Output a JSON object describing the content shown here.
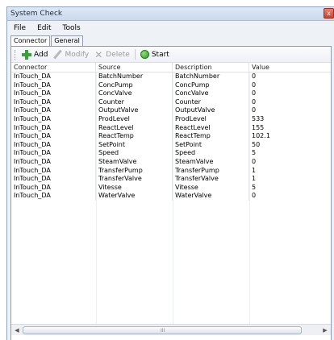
{
  "window": {
    "title": "System Check",
    "close_glyph": "x"
  },
  "menu": [
    "File",
    "Edit",
    "Tools"
  ],
  "tabs": [
    {
      "label": "Connector",
      "active": true
    },
    {
      "label": "General",
      "active": false
    }
  ],
  "toolbar": {
    "add_label": "Add",
    "modify_label": "Modify",
    "delete_label": "Delete",
    "start_label": "Start"
  },
  "grid": {
    "columns": [
      "Connector",
      "Source",
      "Description",
      "Value"
    ],
    "rows": [
      [
        "InTouch_DA",
        "BatchNumber",
        "BatchNumber",
        "0"
      ],
      [
        "InTouch_DA",
        "ConcPump",
        "ConcPump",
        "0"
      ],
      [
        "InTouch_DA",
        "ConcValve",
        "ConcValve",
        "0"
      ],
      [
        "InTouch_DA",
        "Counter",
        "Counter",
        "0"
      ],
      [
        "InTouch_DA",
        "OutputValve",
        "OutputValve",
        "0"
      ],
      [
        "InTouch_DA",
        "ProdLevel",
        "ProdLevel",
        "533"
      ],
      [
        "InTouch_DA",
        "ReactLevel",
        "ReactLevel",
        "155"
      ],
      [
        "InTouch_DA",
        "ReactTemp",
        "ReactTemp",
        "102.1"
      ],
      [
        "InTouch_DA",
        "SetPoint",
        "SetPoint",
        "50"
      ],
      [
        "InTouch_DA",
        "Speed",
        "Speed",
        "5"
      ],
      [
        "InTouch_DA",
        "SteamValve",
        "SteamValve",
        "0"
      ],
      [
        "InTouch_DA",
        "TransferPump",
        "TransferPump",
        "1"
      ],
      [
        "InTouch_DA",
        "TransferValve",
        "TransferValve",
        "1"
      ],
      [
        "InTouch_DA",
        "Vitesse",
        "Vitesse",
        "5"
      ],
      [
        "InTouch_DA",
        "WaterValve",
        "WaterValve",
        "0"
      ]
    ]
  },
  "scrollbar": {
    "grip": "III"
  }
}
